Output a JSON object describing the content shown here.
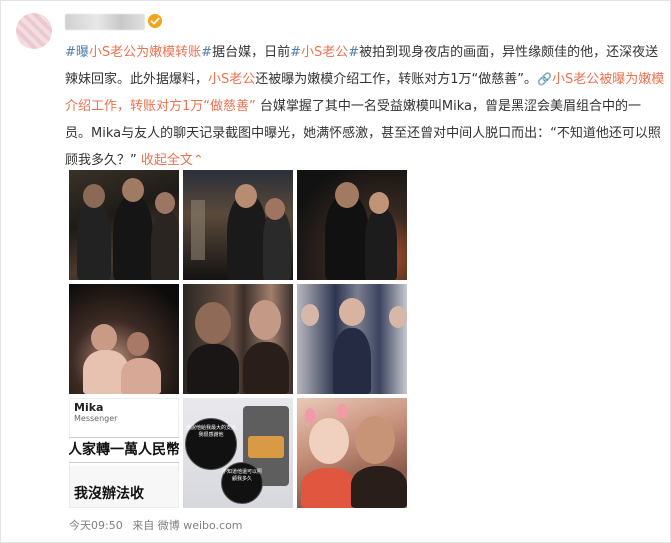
{
  "post": {
    "text": {
      "hashtag1": "#曝",
      "hashtag1_link": "小S老公为嫩模转账",
      "hashtag1_end": "#",
      "seg1": "据台媒，日前",
      "hashtag2_start": "#",
      "hashtag2_link": "小S老公",
      "hashtag2_end": "#",
      "seg2": "被拍到现身夜店的画面，异性缘颇佳的他，还深夜送辣妹回家。此外据爆料，",
      "inline_link1": "小S老公",
      "seg3": "还被曝为嫩模介绍工作，转账对方1万“做慈善”。",
      "link_icon": "🔗",
      "article_link": "小S老公被曝为嫩模介绍工作，转账对方1万“做慈善”",
      "seg4": " 台媒掌握了其中一名受益嫩模叫Mika，曾是黑涩会美眉组合中的一员。Mika与友人的聊天记录截图中曝光，她满怀感激，甚至还曾对中间人脱口而出：“不知道他还可以照顾我多久？”",
      "expand": "收起全文",
      "expand_arrow": "⌃"
    },
    "footer": {
      "time": "今天09:50",
      "source": "来自 微博 weibo.com"
    }
  },
  "photos": {
    "chat_name": "Mika",
    "chat_sub": "Messenger",
    "chat_line1": "人家轉一萬人民幣",
    "chat_line2": "我沒辦法收",
    "bubble1": "他說他給我最大的支持我很感謝他",
    "bubble2": "不知道他還可以照顧我多久"
  },
  "colors": {
    "link": "#eb7350",
    "hashtag": "#507daf",
    "text": "#333333",
    "footer": "#808080",
    "verified": "#f3a41b"
  }
}
